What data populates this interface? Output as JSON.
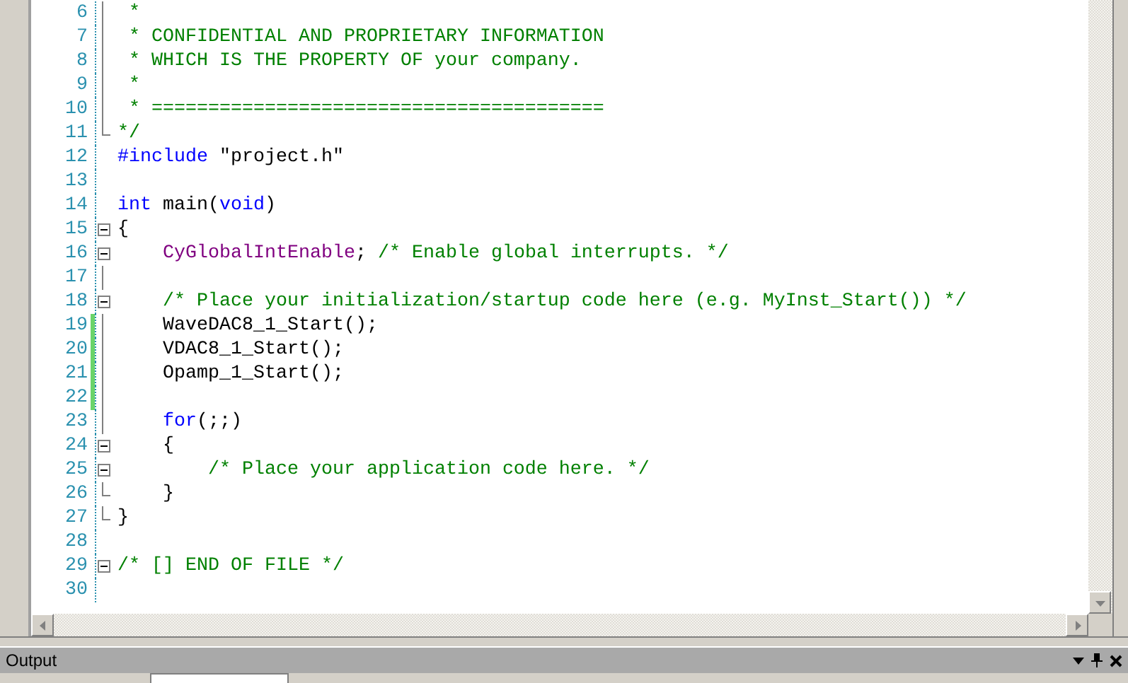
{
  "editor": {
    "lines": [
      {
        "number": "6",
        "fold_start": false,
        "fold_end": false,
        "in_fold": true,
        "changed": false,
        "tokens": [
          {
            "kind": "comment",
            "text": " *"
          }
        ]
      },
      {
        "number": "7",
        "fold_start": false,
        "fold_end": false,
        "in_fold": true,
        "changed": false,
        "tokens": [
          {
            "kind": "comment",
            "text": " * CONFIDENTIAL AND PROPRIETARY INFORMATION"
          }
        ]
      },
      {
        "number": "8",
        "fold_start": false,
        "fold_end": false,
        "in_fold": true,
        "changed": false,
        "tokens": [
          {
            "kind": "comment",
            "text": " * WHICH IS THE PROPERTY OF your company."
          }
        ]
      },
      {
        "number": "9",
        "fold_start": false,
        "fold_end": false,
        "in_fold": true,
        "changed": false,
        "tokens": [
          {
            "kind": "comment",
            "text": " *"
          }
        ]
      },
      {
        "number": "10",
        "fold_start": false,
        "fold_end": false,
        "in_fold": true,
        "changed": false,
        "tokens": [
          {
            "kind": "comment",
            "text": " * ========================================"
          }
        ]
      },
      {
        "number": "11",
        "fold_start": false,
        "fold_end": true,
        "in_fold": false,
        "changed": false,
        "tokens": [
          {
            "kind": "comment",
            "text": "*/"
          }
        ]
      },
      {
        "number": "12",
        "fold_start": false,
        "fold_end": false,
        "in_fold": false,
        "changed": false,
        "tokens": [
          {
            "kind": "keyword",
            "text": "#include"
          },
          {
            "kind": "plain",
            "text": " \"project.h\""
          }
        ]
      },
      {
        "number": "13",
        "fold_start": false,
        "fold_end": false,
        "in_fold": false,
        "changed": false
      },
      {
        "number": "14",
        "fold_start": false,
        "fold_end": false,
        "in_fold": false,
        "changed": false,
        "tokens": [
          {
            "kind": "keyword",
            "text": "int"
          },
          {
            "kind": "plain",
            "text": " main("
          },
          {
            "kind": "keyword",
            "text": "void"
          },
          {
            "kind": "plain",
            "text": ")"
          }
        ]
      },
      {
        "number": "15",
        "fold_start": true,
        "fold_end": false,
        "in_fold": false,
        "changed": false,
        "tokens": [
          {
            "kind": "plain",
            "text": "{"
          }
        ]
      },
      {
        "number": "16",
        "fold_start": true,
        "fold_end": false,
        "in_fold": false,
        "changed": false,
        "tokens": [
          {
            "kind": "function",
            "text": "    CyGlobalIntEnable"
          },
          {
            "kind": "plain",
            "text": "; "
          },
          {
            "kind": "comment",
            "text": "/* Enable global interrupts. */"
          }
        ]
      },
      {
        "number": "17",
        "fold_start": false,
        "fold_end": false,
        "in_fold": true,
        "changed": false
      },
      {
        "number": "18",
        "fold_start": true,
        "fold_end": false,
        "in_fold": false,
        "changed": false,
        "tokens": [
          {
            "kind": "comment",
            "text": "    /* Place your initialization/startup code here (e.g. MyInst_Start()) */"
          }
        ]
      },
      {
        "number": "19",
        "fold_start": false,
        "fold_end": false,
        "in_fold": true,
        "changed": true,
        "tokens": [
          {
            "kind": "plain",
            "text": "    WaveDAC8_1_Start();"
          }
        ]
      },
      {
        "number": "20",
        "fold_start": false,
        "fold_end": false,
        "in_fold": true,
        "changed": true,
        "tokens": [
          {
            "kind": "plain",
            "text": "    VDAC8_1_Start();"
          }
        ]
      },
      {
        "number": "21",
        "fold_start": false,
        "fold_end": false,
        "in_fold": true,
        "changed": true,
        "tokens": [
          {
            "kind": "plain",
            "text": "    Opamp_1_Start();"
          }
        ]
      },
      {
        "number": "22",
        "fold_start": false,
        "fold_end": false,
        "in_fold": true,
        "changed": true
      },
      {
        "number": "23",
        "fold_start": false,
        "fold_end": false,
        "in_fold": true,
        "changed": false,
        "tokens": [
          {
            "kind": "keyword",
            "text": "    for"
          },
          {
            "kind": "plain",
            "text": "(;;)"
          }
        ]
      },
      {
        "number": "24",
        "fold_start": true,
        "fold_end": false,
        "in_fold": false,
        "changed": false,
        "tokens": [
          {
            "kind": "plain",
            "text": "    {"
          }
        ]
      },
      {
        "number": "25",
        "fold_start": true,
        "fold_end": false,
        "in_fold": false,
        "changed": false,
        "tokens": [
          {
            "kind": "comment",
            "text": "        /* Place your application code here. */"
          }
        ]
      },
      {
        "number": "26",
        "fold_start": false,
        "fold_end": true,
        "in_fold": false,
        "changed": false,
        "tokens": [
          {
            "kind": "plain",
            "text": "    }"
          }
        ]
      },
      {
        "number": "27",
        "fold_start": false,
        "fold_end": true,
        "in_fold": false,
        "changed": false,
        "tokens": [
          {
            "kind": "plain",
            "text": "}"
          }
        ]
      },
      {
        "number": "28",
        "fold_start": false,
        "fold_end": false,
        "in_fold": false,
        "changed": false
      },
      {
        "number": "29",
        "fold_start": true,
        "fold_end": false,
        "in_fold": false,
        "changed": false,
        "tokens": [
          {
            "kind": "comment",
            "text": "/* [] END OF FILE */"
          }
        ]
      },
      {
        "number": "30",
        "fold_start": false,
        "fold_end": false,
        "in_fold": false,
        "changed": false
      }
    ]
  },
  "output": {
    "title": "Output"
  }
}
